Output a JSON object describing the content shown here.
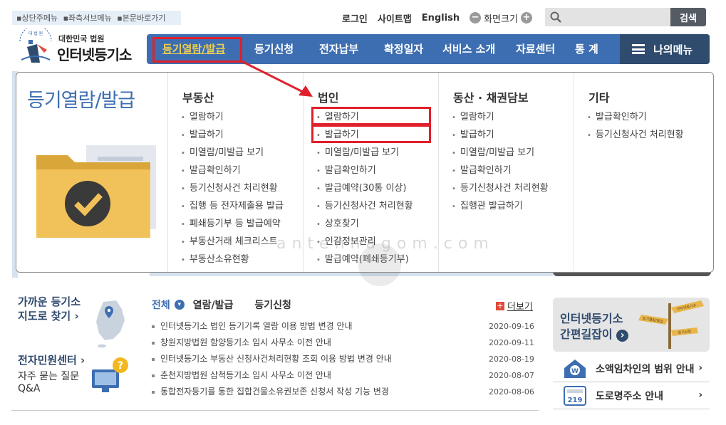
{
  "skip_links": [
    "▪상단주메뉴",
    "▪좌측서브메뉴",
    "▪본문바로가기"
  ],
  "util": {
    "login": "로그인",
    "sitemap": "사이트맵",
    "english": "English",
    "zoom_label": "화면크기",
    "zoom_out": "−",
    "zoom_in": "+"
  },
  "search": {
    "placeholder": "",
    "button": "검색"
  },
  "logo": {
    "sub": "대한민국 법원",
    "main": "인터넷등기소",
    "emblem_text": "대 법 원"
  },
  "gnb": {
    "items": [
      "등기열람/발급",
      "등기신청",
      "전자납부",
      "확정일자",
      "서비스 소개",
      "자료센터",
      "통 계"
    ],
    "my_menu": "나의메뉴"
  },
  "mega": {
    "title": "등기열람/발급",
    "columns": [
      {
        "heading": "부동산",
        "items": [
          "열람하기",
          "발급하기",
          "미열람/미발급 보기",
          "발급확인하기",
          "등기신청사건 처리현황",
          "집행 등 전자제출용 발급",
          "폐쇄등기부 등 발급예약",
          "부동산거래 체크리스트",
          "부동산소유현황"
        ]
      },
      {
        "heading": "법인",
        "items": [
          "열람하기",
          "발급하기",
          "미열람/미발급 보기",
          "발급확인하기",
          "발급예약(30통 이상)",
          "등기신청사건 처리현황",
          "상호찾기",
          "인감정보관리",
          "발급예약(폐쇄등기부)"
        ]
      },
      {
        "heading": "동산 · 채권담보",
        "items": [
          "열람하기",
          "발급하기",
          "미열람/미발급 보기",
          "발급확인하기",
          "등기신청사건 처리현황",
          "집행관 발급하기"
        ]
      },
      {
        "heading": "기타",
        "items": [
          "발급확인하기",
          "등기신청사건 처리현황"
        ]
      }
    ]
  },
  "watermark": "antennagom.com",
  "left_links": {
    "map_line1": "가까운 등기소",
    "map_line2": "지도로 찾기 ›",
    "center": "전자민원센터 ›",
    "faq_line1": "자주 묻는 질문",
    "faq_line2": "Q&A"
  },
  "news": {
    "tabs": [
      "전체",
      "열람/발급",
      "등기신청"
    ],
    "more": "더보기",
    "more_icon": "+",
    "items": [
      {
        "title": "인터넷등기소 법인 등기기록 열람 이용 방법 변경 안내",
        "date": "2020-09-16"
      },
      {
        "title": "창원지방법원 함양등기소 임시 사무소 이전 안내",
        "date": "2020-09-11"
      },
      {
        "title": "인터넷등기소 부동산 신청사건처리현황 조회 이용 방법 변경 안내",
        "date": "2020-08-19"
      },
      {
        "title": "춘천지방법원 삼척등기소 임시 사무소 이전 안내",
        "date": "2020-08-07"
      },
      {
        "title": "통합전자등기를 통한 집합건물소유권보존 신청서 작성 기능 변경",
        "date": "2020-08-06"
      }
    ]
  },
  "right": {
    "guide_line1": "인터넷등기소",
    "guide_line2": "간편길잡이",
    "guide_arrow": "›",
    "signs": [
      "인터넷등기소",
      "등기열람/발급",
      "등기신청"
    ],
    "links": [
      "소액임차인의 범위 안내",
      "도로명주소 안내"
    ],
    "link_arrow": "›",
    "road_sign_text": "219"
  },
  "colors": {
    "primary": "#3d6eb1",
    "dark": "#2f4b6e",
    "highlight": "#e0202a",
    "accent_yellow": "#f3d04a"
  }
}
